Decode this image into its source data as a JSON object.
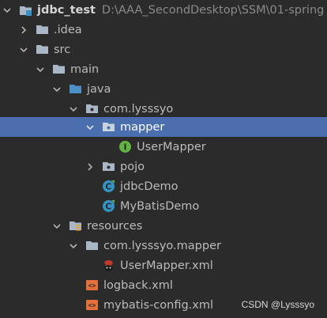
{
  "tree": {
    "root": {
      "label": "jdbc_test",
      "path": "D:\\AAA_SecondDesktop\\SSM\\01-spring"
    },
    "idea": {
      "label": ".idea"
    },
    "src": {
      "label": "src"
    },
    "main": {
      "label": "main"
    },
    "java": {
      "label": "java"
    },
    "package": {
      "label": "com.lysssyo"
    },
    "mapper": {
      "label": "mapper"
    },
    "usermapper": {
      "label": "UserMapper"
    },
    "pojo": {
      "label": "pojo"
    },
    "jdbcdemo": {
      "label": "jdbcDemo"
    },
    "mybatisdemo": {
      "label": "MyBatisDemo"
    },
    "resources": {
      "label": "resources"
    },
    "resmapper": {
      "label": "com.lysssyo.mapper"
    },
    "usermapperxml": {
      "label": "UserMapper.xml"
    },
    "logback": {
      "label": "logback.xml"
    },
    "mybatisconfig": {
      "label": "mybatis-config.xml"
    }
  },
  "watermark": "CSDN @Lysssyo",
  "colors": {
    "background": "#2b2b2b",
    "selection": "#4b6eaf",
    "folder": "#a9b7c6",
    "source_folder": "#4d8fc7",
    "interface_icon": "#62b543",
    "class_icon": "#3592c4",
    "xml_icon": "#e36f3a"
  },
  "icons": [
    "module-icon",
    "folder-icon",
    "source-folder-icon",
    "package-icon",
    "interface-icon",
    "class-icon",
    "resources-folder-icon",
    "mybatis-icon",
    "xml-icon"
  ]
}
